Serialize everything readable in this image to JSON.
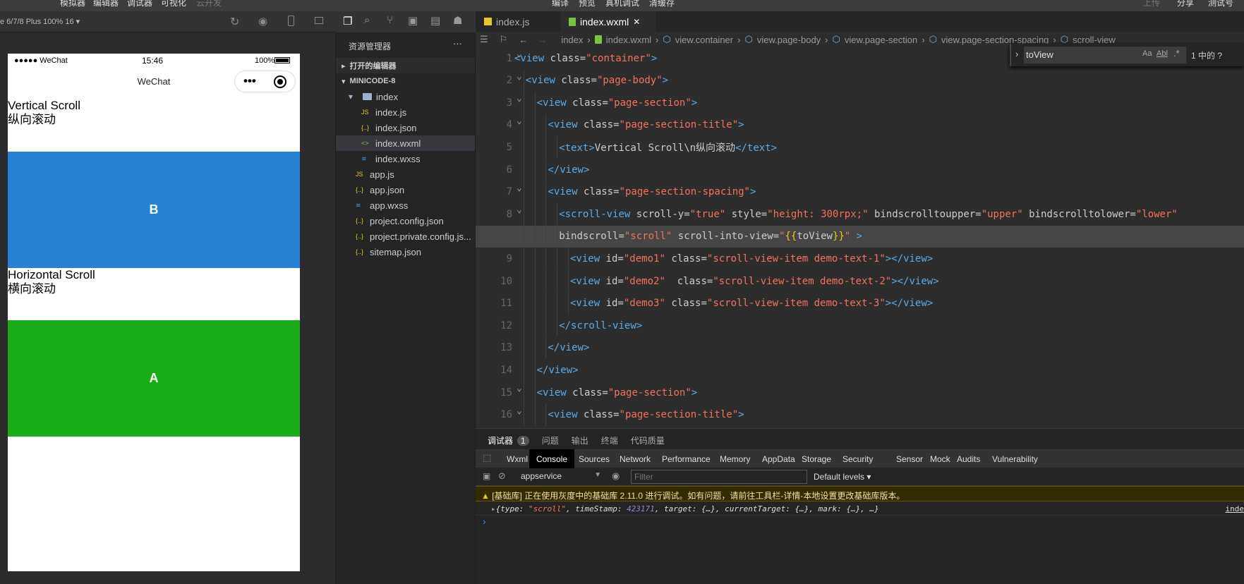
{
  "menu": {
    "left": [
      "模拟器",
      "编辑器",
      "调试器",
      "可视化",
      "云开发"
    ],
    "right": [
      "编译",
      "预览",
      "真机调试",
      "清缓存"
    ],
    "far": [
      "上传",
      "分享",
      "测试号"
    ]
  },
  "sim": {
    "device": "e 6/7/8 Plus 100% 16 ▾",
    "status": {
      "carrier": "●●●●● WeChat",
      "time": "15:46",
      "battery": "100%"
    },
    "nav_title": "WeChat",
    "capsule_more": "•••",
    "section1": {
      "title": "Vertical Scroll",
      "subtitle": "纵向滚动",
      "block": "B",
      "color": "#2782d7"
    },
    "section2": {
      "title": "Horizontal Scroll",
      "subtitle": "横向滚动",
      "block": "A",
      "color": "#1aad19"
    }
  },
  "explorer": {
    "title": "资源管理器",
    "more": "···",
    "open_editors": "打开的编辑器",
    "project": "MINICODE-8",
    "items": [
      {
        "name": "index",
        "type": "folder",
        "depth": 1
      },
      {
        "name": "index.js",
        "type": "js",
        "depth": 2
      },
      {
        "name": "index.json",
        "type": "json",
        "depth": 2
      },
      {
        "name": "index.wxml",
        "type": "wxml",
        "depth": 2,
        "selected": true
      },
      {
        "name": "index.wxss",
        "type": "wxss",
        "depth": 2
      },
      {
        "name": "app.js",
        "type": "js",
        "depth": 1
      },
      {
        "name": "app.json",
        "type": "json",
        "depth": 1
      },
      {
        "name": "app.wxss",
        "type": "wxss",
        "depth": 1
      },
      {
        "name": "project.config.json",
        "type": "json",
        "depth": 1
      },
      {
        "name": "project.private.config.js...",
        "type": "json",
        "depth": 1
      },
      {
        "name": "sitemap.json",
        "type": "json",
        "depth": 1
      }
    ]
  },
  "editor": {
    "tabs": [
      {
        "label": "index.js"
      },
      {
        "label": "index.wxml",
        "close": "✕"
      }
    ],
    "breadcrumb": [
      "index",
      "index.wxml",
      "view.container",
      "view.page-body",
      "view.page-section",
      "view.page-section-spacing",
      "scroll-view"
    ],
    "find": {
      "value": "toView",
      "case": "Aa",
      "word": "Abl",
      "regex": ".*",
      "result": "1 中的 ?"
    },
    "lines": [
      {
        "n": "1",
        "i": 0,
        "t": [
          [
            "tg",
            "<view "
          ],
          [
            "at",
            "class="
          ],
          [
            "st",
            "\"container\""
          ],
          [
            "tg",
            ">"
          ]
        ]
      },
      {
        "n": "2",
        "i": 1,
        "t": [
          [
            "tg",
            "<view "
          ],
          [
            "at",
            "class="
          ],
          [
            "st",
            "\"page-body\""
          ],
          [
            "tg",
            ">"
          ]
        ]
      },
      {
        "n": "3",
        "i": 2,
        "t": [
          [
            "tg",
            "<view "
          ],
          [
            "at",
            "class="
          ],
          [
            "st",
            "\"page-section\""
          ],
          [
            "tg",
            ">"
          ]
        ]
      },
      {
        "n": "4",
        "i": 3,
        "t": [
          [
            "tg",
            "<view "
          ],
          [
            "at",
            "class="
          ],
          [
            "st",
            "\"page-section-title\""
          ],
          [
            "tg",
            ">"
          ]
        ]
      },
      {
        "n": "5",
        "i": 4,
        "t": [
          [
            "tg",
            "<text>"
          ],
          [
            "at",
            "Vertical Scroll\\n纵向滚动"
          ],
          [
            "tg",
            "</text>"
          ]
        ]
      },
      {
        "n": "6",
        "i": 3,
        "t": [
          [
            "tg",
            "</view>"
          ]
        ]
      },
      {
        "n": "7",
        "i": 3,
        "t": [
          [
            "tg",
            "<view "
          ],
          [
            "at",
            "class="
          ],
          [
            "st",
            "\"page-section-spacing\""
          ],
          [
            "tg",
            ">"
          ]
        ]
      },
      {
        "n": "8",
        "i": 4,
        "t": [
          [
            "tg",
            "<scroll-view "
          ],
          [
            "at",
            "scroll-y="
          ],
          [
            "st",
            "\"true\""
          ],
          [
            "at",
            " style="
          ],
          [
            "st",
            "\"height: 300rpx;\""
          ],
          [
            "at",
            " bindscrolltoupper="
          ],
          [
            "st",
            "\"upper\""
          ],
          [
            "at",
            " bindscrolltolower="
          ],
          [
            "st",
            "\"lower\""
          ]
        ]
      },
      {
        "n": "",
        "i": 4,
        "hl": true,
        "t": [
          [
            "at",
            "bindscroll="
          ],
          [
            "st",
            "\"scroll\""
          ],
          [
            "at",
            " scroll-into-view="
          ],
          [
            "st",
            "\""
          ],
          [
            "br",
            "{{"
          ],
          [
            "at",
            "toView"
          ],
          [
            "br",
            "}}"
          ],
          [
            "st",
            "\""
          ],
          [
            "tg",
            " >"
          ]
        ]
      },
      {
        "n": "9",
        "i": 5,
        "t": [
          [
            "tg",
            "<view "
          ],
          [
            "at",
            "id="
          ],
          [
            "st",
            "\"demo1\""
          ],
          [
            "at",
            " class="
          ],
          [
            "st",
            "\"scroll-view-item demo-text-1\""
          ],
          [
            "tg",
            "></view>"
          ]
        ]
      },
      {
        "n": "10",
        "i": 5,
        "t": [
          [
            "tg",
            "<view "
          ],
          [
            "at",
            "id="
          ],
          [
            "st",
            "\"demo2\""
          ],
          [
            "at",
            "  class="
          ],
          [
            "st",
            "\"scroll-view-item demo-text-2\""
          ],
          [
            "tg",
            "></view>"
          ]
        ]
      },
      {
        "n": "11",
        "i": 5,
        "t": [
          [
            "tg",
            "<view "
          ],
          [
            "at",
            "id="
          ],
          [
            "st",
            "\"demo3\""
          ],
          [
            "at",
            " class="
          ],
          [
            "st",
            "\"scroll-view-item demo-text-3\""
          ],
          [
            "tg",
            "></view>"
          ]
        ]
      },
      {
        "n": "12",
        "i": 4,
        "t": [
          [
            "tg",
            "</scroll-view>"
          ]
        ]
      },
      {
        "n": "13",
        "i": 3,
        "t": [
          [
            "tg",
            "</view>"
          ]
        ]
      },
      {
        "n": "14",
        "i": 2,
        "t": [
          [
            "tg",
            "</view>"
          ]
        ]
      },
      {
        "n": "15",
        "i": 2,
        "t": [
          [
            "tg",
            "<view "
          ],
          [
            "at",
            "class="
          ],
          [
            "st",
            "\"page-section\""
          ],
          [
            "tg",
            ">"
          ]
        ]
      },
      {
        "n": "16",
        "i": 3,
        "t": [
          [
            "tg",
            "<view "
          ],
          [
            "at",
            "class="
          ],
          [
            "st",
            "\"page-section-title\""
          ],
          [
            "tg",
            ">"
          ]
        ]
      }
    ]
  },
  "devtools": {
    "panel_tabs": [
      "调试器",
      "问题",
      "输出",
      "终端",
      "代码质量"
    ],
    "badge": "1",
    "tabs": [
      "Wxml",
      "Console",
      "Sources",
      "Network",
      "Performance",
      "Memory",
      "AppData",
      "Storage",
      "Security",
      "Sensor",
      "Mock",
      "Audits",
      "Vulnerability"
    ],
    "context": "appservice",
    "filter_placeholder": "Filter",
    "levels": "Default levels ▾",
    "warning": "[基础库] 正在使用灰度中的基础库 2.11.0 进行调试。如有问题，请前往工具栏-详情-本地设置更改基础库版本。",
    "log": {
      "prefix": "{type: ",
      "type": "\"scroll\"",
      "mid": ", timeStamp: ",
      "ts": "423171",
      "rest": ", target: {…}, currentTarget: {…}, mark: {…}, …}",
      "src": "inde"
    },
    "prompt": "›"
  }
}
